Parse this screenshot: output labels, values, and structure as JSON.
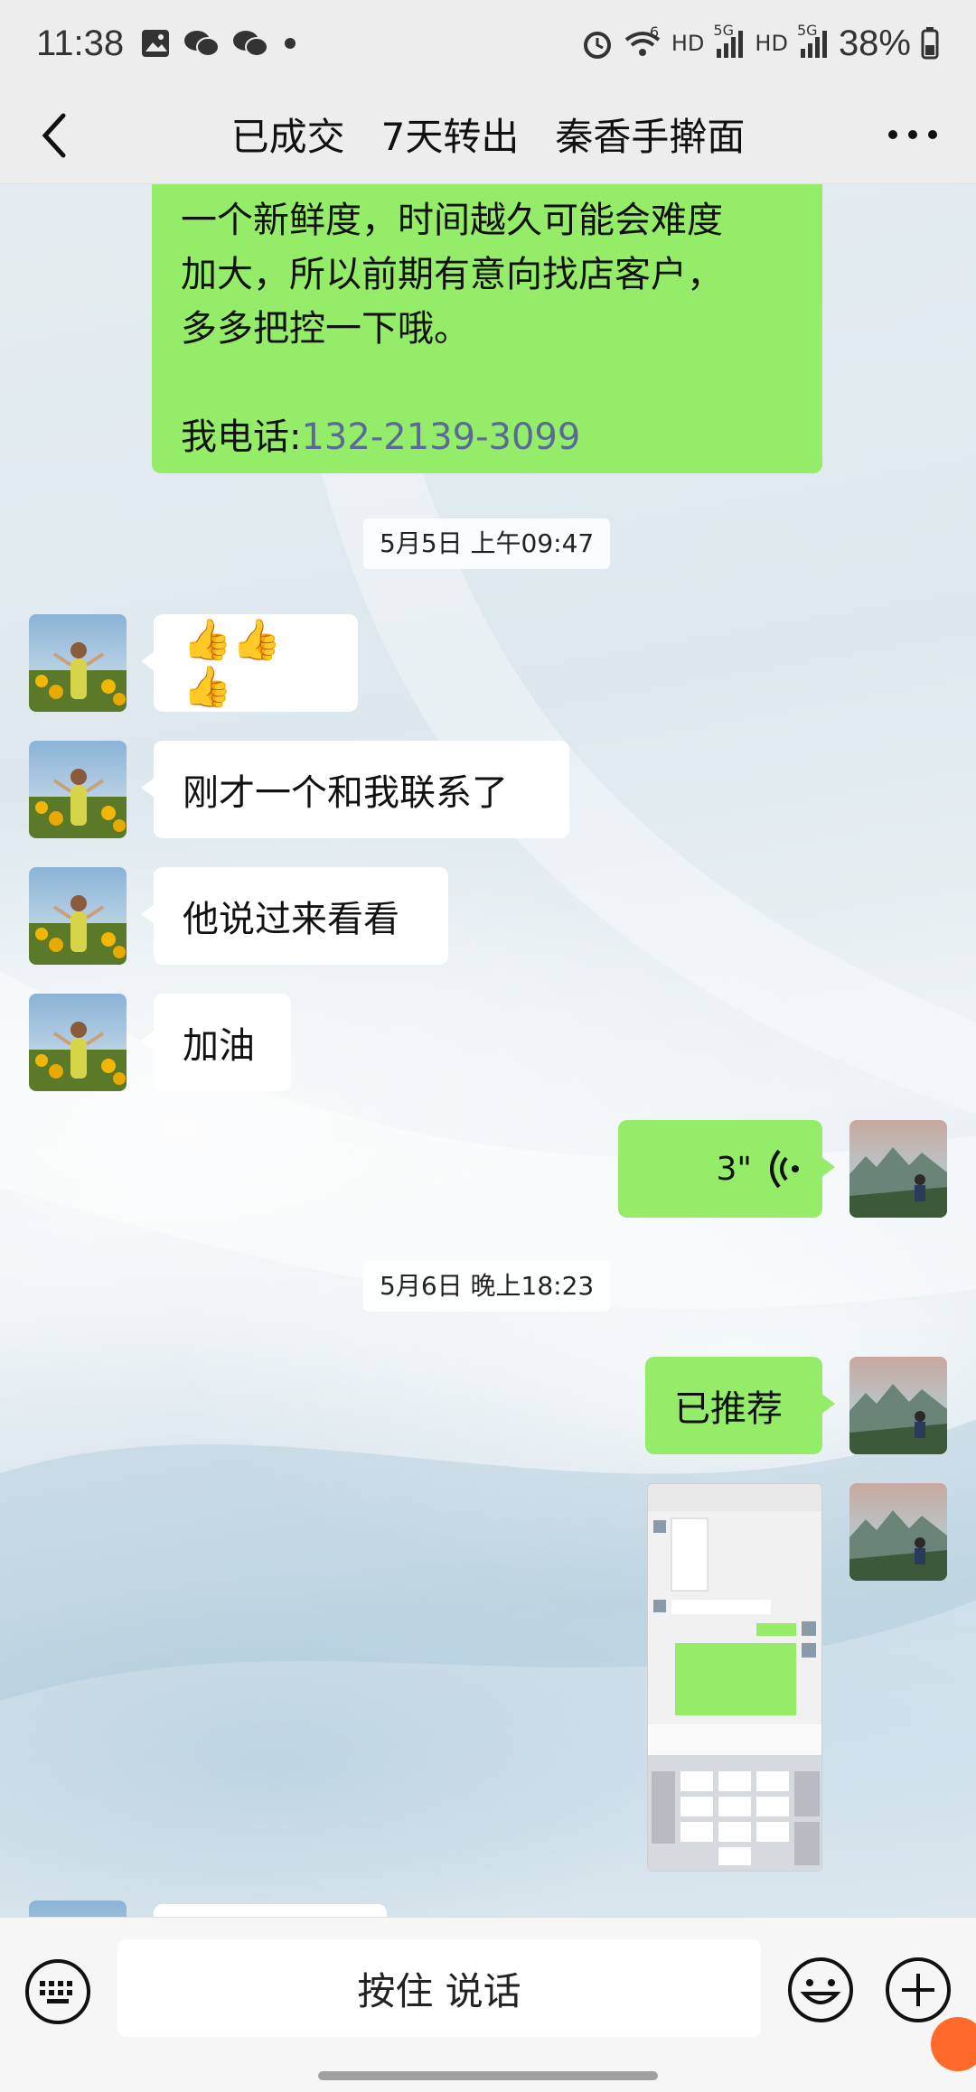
{
  "status_bar": {
    "time": "11:38",
    "net_label_1": "HD",
    "net_label_2": "HD",
    "signal_label_1": "5G",
    "signal_label_2": "5G",
    "wifi_label": "6",
    "battery": "38%"
  },
  "nav": {
    "title": "已成交   7天转出   秦香手擀面"
  },
  "messages": {
    "first": {
      "lines": [
        "一个新鲜度，时间越久可能会难度",
        "加大，所以前期有意向找店客户，",
        "多多把控一下哦。"
      ],
      "phone_label": "我电话:",
      "phone_number": "132-2139-3099"
    },
    "timestamp_1": "5月5日 上午09:47",
    "thumbs": "👍👍👍",
    "msg_2": "刚才一个和我联系了",
    "msg_3": "他说过来看看",
    "msg_4": "加油",
    "voice_duration": "3\"",
    "timestamp_2": "5月6日 晚上18:23",
    "msg_5": "已推荐"
  },
  "input_bar": {
    "hold_to_talk": "按住 说话"
  },
  "colors": {
    "green_bubble": "#95ec69",
    "link": "#576b95",
    "bar_bg": "#ededed"
  }
}
